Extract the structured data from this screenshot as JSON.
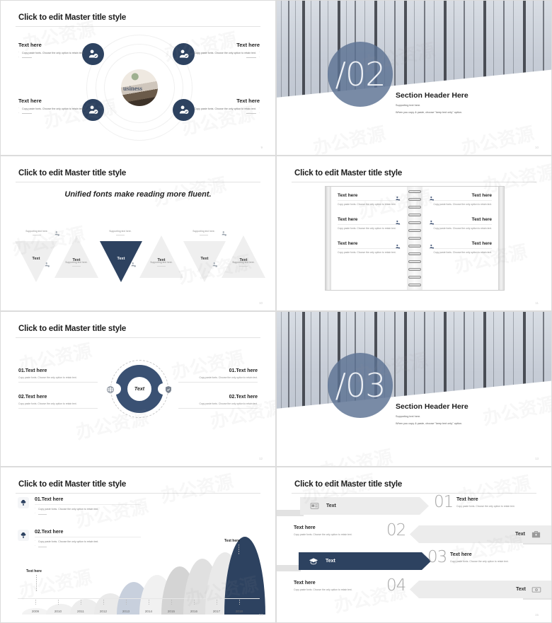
{
  "common": {
    "master_title": "Click to edit Master title style",
    "body_copy": "Copy paste fonts. Choose the only option to retain text.",
    "text_here": "Text here",
    "supporting_text": "Supporting text here.",
    "colors": {
      "navy": "#2d4260",
      "slate": "#5c7293",
      "grey": "#ececec"
    }
  },
  "watermark": {
    "text": "办公资源"
  },
  "slide1": {
    "title": "Click to edit Master title style",
    "page": "9",
    "photo_word": "usiness",
    "items": [
      {
        "heading": "Text here",
        "bullet1": "Copy paste fonts. Choose the only option to retain text.",
        "icon": "user-check-icon"
      },
      {
        "heading": "Text here",
        "bullet1": "Copy paste fonts. Choose the only option to retain text.",
        "icon": "user-check-icon"
      },
      {
        "heading": "Text here",
        "bullet1": "Copy paste fonts. Choose the only option to retain text.",
        "icon": "user-check-icon"
      },
      {
        "heading": "Text here",
        "bullet1": "Copy paste fonts. Choose the only option to retain text.",
        "icon": "user-check-icon"
      }
    ]
  },
  "slide2": {
    "number": "/02",
    "header": "Section Header Here",
    "sub1": "Supporting text here.",
    "sub2": "When you copy & paste, choose \"keep text only\" option.",
    "page": "10"
  },
  "slide3": {
    "title": "Click to edit Master title style",
    "quote": "Unified fonts make reading more fluent.",
    "page": "10",
    "triangles": [
      {
        "label": "Text",
        "support": "Supporting text here.",
        "dir": "down",
        "accent": false
      },
      {
        "label": "Text",
        "support": "Supporting text here.",
        "dir": "up",
        "accent": false
      },
      {
        "label": "Text",
        "support": "Supporting text here.",
        "dir": "down",
        "accent": true
      },
      {
        "label": "Text",
        "support": "Supporting text here.",
        "dir": "up",
        "accent": false
      },
      {
        "label": "Text",
        "support": "Supporting text here.",
        "dir": "down",
        "accent": false
      },
      {
        "label": "Text",
        "support": "Supporting text here.",
        "dir": "up",
        "accent": false
      }
    ]
  },
  "slide4": {
    "title": "Click to edit Master title style",
    "page": "11",
    "left_items": [
      {
        "heading": "Text here",
        "body": "Copy paste fonts. Choose the only option to retain text.",
        "icon": "user-add-icon"
      },
      {
        "heading": "Text here",
        "body": "Copy paste fonts. Choose the only option to retain text.",
        "icon": "user-add-icon"
      },
      {
        "heading": "Text here",
        "body": "Copy paste fonts. Choose the only option to retain text.",
        "icon": "user-add-icon"
      }
    ],
    "right_items": [
      {
        "heading": "Text here",
        "body": "Copy paste fonts. Choose the only option to retain text.",
        "icon": "user-add-icon"
      },
      {
        "heading": "Text here",
        "body": "Copy paste fonts. Choose the only option to retain text.",
        "icon": "user-add-icon"
      },
      {
        "heading": "Text here",
        "body": "Copy paste fonts. Choose the only option to retain text.",
        "icon": "user-add-icon"
      }
    ]
  },
  "slide5": {
    "title": "Click to edit Master title style",
    "center_label": "Text",
    "page": "12",
    "left": [
      {
        "heading": "01.Text here",
        "body": "Copy paste fonts. Choose the only option to retain text."
      },
      {
        "heading": "02.Text here",
        "body": "Copy paste fonts. Choose the only option to retain text."
      }
    ],
    "right": [
      {
        "heading": "01.Text here",
        "body": "Copy paste fonts. Choose the only option to retain text."
      },
      {
        "heading": "02.Text here",
        "body": "Copy paste fonts. Choose the only option to retain text."
      }
    ],
    "icons": {
      "left": "globe-icon",
      "right": "shield-check-icon"
    }
  },
  "slide6": {
    "number": "/03",
    "header": "Section Header Here",
    "sub1": "Supporting text here.",
    "sub2": "When you copy & paste, choose \"keep text only\" option.",
    "page": "13"
  },
  "slide7": {
    "title": "Click to edit Master title style",
    "page": "14",
    "callout_left": "Text here",
    "callout_right": "Text here",
    "features": [
      {
        "heading": "01.Text here",
        "bullet": "Copy paste fonts. Choose the only option to retain text.",
        "icon": "tree-icon"
      },
      {
        "heading": "02.Text here",
        "bullet": "Copy paste fonts. Choose the only option to retain text.",
        "icon": "tree-icon"
      }
    ],
    "chart_data": {
      "type": "area",
      "title": "",
      "xlabel": "",
      "ylabel": "",
      "categories": [
        "2009",
        "2010",
        "2011",
        "2012",
        "2013",
        "2014",
        "2015",
        "2016",
        "2017",
        "2018"
      ],
      "values": [
        8,
        14,
        20,
        27,
        42,
        51,
        62,
        72,
        80,
        100
      ],
      "ylim": [
        0,
        100
      ],
      "grid": false,
      "legend": "none",
      "annotations": [
        {
          "text": "Text here",
          "category": "2009"
        },
        {
          "text": "Text here",
          "category": "2018"
        }
      ],
      "colors": [
        "#f0f0f0",
        "#ededed",
        "#eaeaea",
        "#e7e7e7",
        "#c8d0dd",
        "#efefef",
        "#d5d5d5",
        "#e0e0e0",
        "#e9e9e9",
        "#2d4260"
      ]
    }
  },
  "slide8": {
    "title": "Click to edit Master title style",
    "page": "15",
    "rows": [
      {
        "number": "01",
        "bar_label": "Text",
        "icon": "newspaper-icon",
        "heading": "Text here",
        "body": "Copy paste fonts. Choose the only option to retain text.",
        "dir": "ltr",
        "accent": false
      },
      {
        "number": "02",
        "bar_label": "Text",
        "icon": "briefcase-icon",
        "heading": "Text here",
        "body": "Copy paste fonts. Choose the only option to retain text.",
        "dir": "rtl",
        "accent": false
      },
      {
        "number": "03",
        "bar_label": "Text",
        "icon": "graduation-cap-icon",
        "heading": "Text here",
        "body": "Copy paste fonts. Choose the only option to retain text.",
        "dir": "ltr",
        "accent": true
      },
      {
        "number": "04",
        "bar_label": "Text",
        "icon": "banknote-icon",
        "heading": "Text here",
        "body": "Copy paste fonts. Choose the only option to retain text.",
        "dir": "rtl",
        "accent": false
      }
    ]
  }
}
